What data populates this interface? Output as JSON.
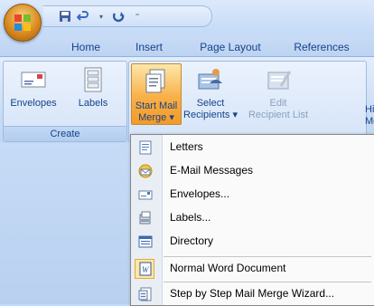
{
  "quick_access": {
    "save_icon": "save-icon",
    "undo_icon": "undo-icon",
    "redo_icon": "redo-icon",
    "customize_icon": "customize-arrow-icon"
  },
  "tabs": [
    "Home",
    "Insert",
    "Page Layout",
    "References"
  ],
  "ribbon": {
    "create_group": {
      "label": "Create",
      "envelopes": "Envelopes",
      "labels": "Labels"
    },
    "start_mail_merge": {
      "line1": "Start Mail",
      "line2": "Merge ▾"
    },
    "select_recipients": {
      "line1": "Select",
      "line2": "Recipients ▾"
    },
    "edit_recipient_list": {
      "line1": "Edit",
      "line2": "Recipient List"
    },
    "highlight_partial": {
      "line1": "Hig",
      "line2": "Merg"
    }
  },
  "menu": {
    "items": [
      {
        "label": "Letters",
        "icon": "letter-document-icon"
      },
      {
        "label": "E-Mail Messages",
        "icon": "email-message-icon"
      },
      {
        "label": "Envelopes...",
        "icon": "envelope-icon"
      },
      {
        "label": "Labels...",
        "icon": "labels-icon"
      },
      {
        "label": "Directory",
        "icon": "directory-icon"
      },
      {
        "label": "Normal Word Document",
        "icon": "word-document-icon"
      },
      {
        "label": "Step by Step Mail Merge Wizard...",
        "icon": "wizard-icon"
      }
    ]
  }
}
